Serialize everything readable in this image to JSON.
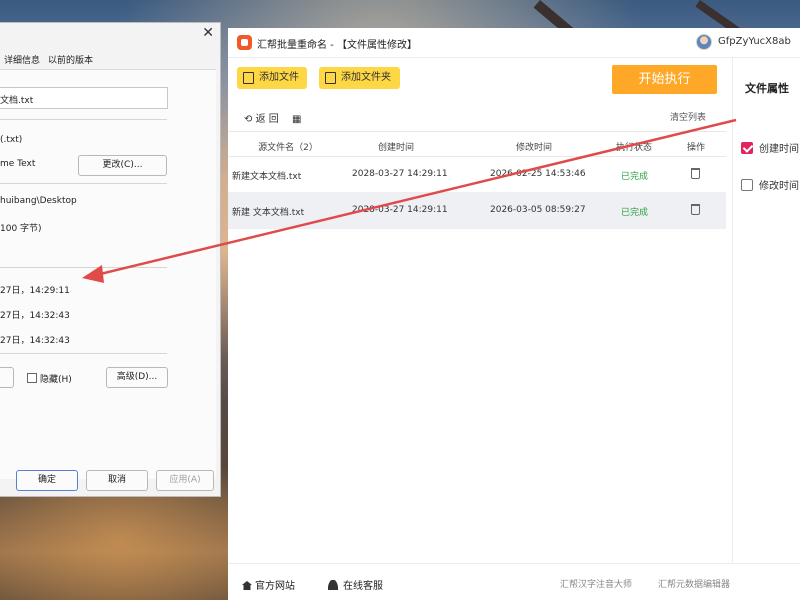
{
  "properties_dialog": {
    "close_glyph": "✕",
    "tabs": [
      "详细信息",
      "以前的版本"
    ],
    "file_name": "文档.txt",
    "type_text": "(.txt)",
    "opens_with_text": "me Text",
    "change_button": "更改(C)...",
    "location_text": "huibang\\Desktop",
    "size_text": "100 字节)",
    "created_text": "27日，14:29:11",
    "modified_text": "27日，14:32:43",
    "accessed_text": "27日，14:32:43",
    "hidden_label": "隐藏(H)",
    "advanced_button": "高级(D)...",
    "ok_button": "确定",
    "cancel_button": "取消",
    "apply_button": "应用(A)"
  },
  "app": {
    "title": "汇帮批量重命名 - 【文件属性修改】",
    "username": "GfpZyYucX8ab",
    "add_file": "添加文件",
    "add_folder": "添加文件夹",
    "start": "开始执行",
    "back": "返 回",
    "clear_list": "清空列表",
    "accent_color": "#ffa726",
    "button_color": "#fdd744",
    "table": {
      "headers": [
        "源文件名（2）",
        "创建时间",
        "修改时间",
        "执行状态",
        "操作"
      ],
      "rows": [
        {
          "name": "新建文本文档.txt",
          "created": "2028-03-27 14:29:11",
          "modified": "2026-02-25 14:53:46",
          "status": "已完成"
        },
        {
          "name": "新建 文本文档.txt",
          "created": "2028-03-27 14:29:11",
          "modified": "2026-03-05 08:59:27",
          "status": "已完成"
        }
      ]
    },
    "side_panel": {
      "title": "文件属性",
      "options": [
        {
          "label": "创建时间",
          "checked": true
        },
        {
          "label": "修改时间",
          "checked": false
        }
      ]
    },
    "footer": {
      "website": "官方网站",
      "support": "在线客服",
      "link1": "汇帮汉字注音大师",
      "link2": "汇帮元数据编辑器"
    }
  }
}
